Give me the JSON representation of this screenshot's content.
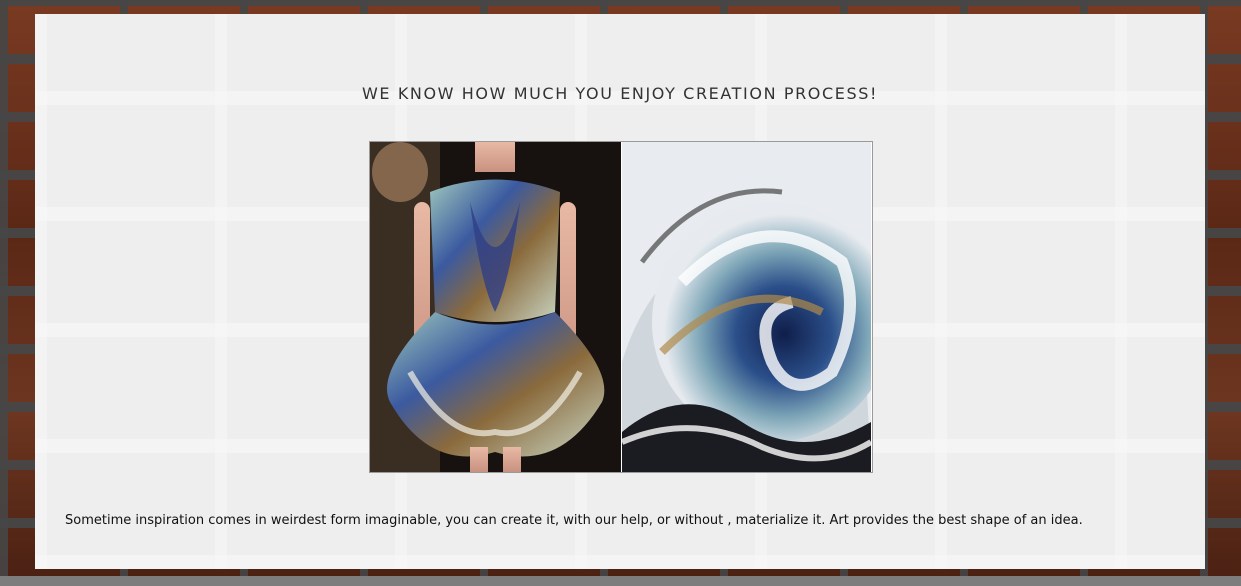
{
  "headline": "WE KNOW HOW MUCH YOU ENJOY CREATION PROCESS!",
  "images": [
    {
      "name": "dress-photo",
      "description_icon": "runway-dress-image"
    },
    {
      "name": "wave-painting",
      "description_icon": "ocean-wave-painting-image"
    }
  ],
  "caption": "Sometime inspiration comes in weirdest form imaginable, you can create it, with our help, or without , materialize it. Art provides the best shape of an idea.",
  "colors": {
    "panel": "#efeeee",
    "text": "#333333",
    "brick": "#6d3620"
  }
}
